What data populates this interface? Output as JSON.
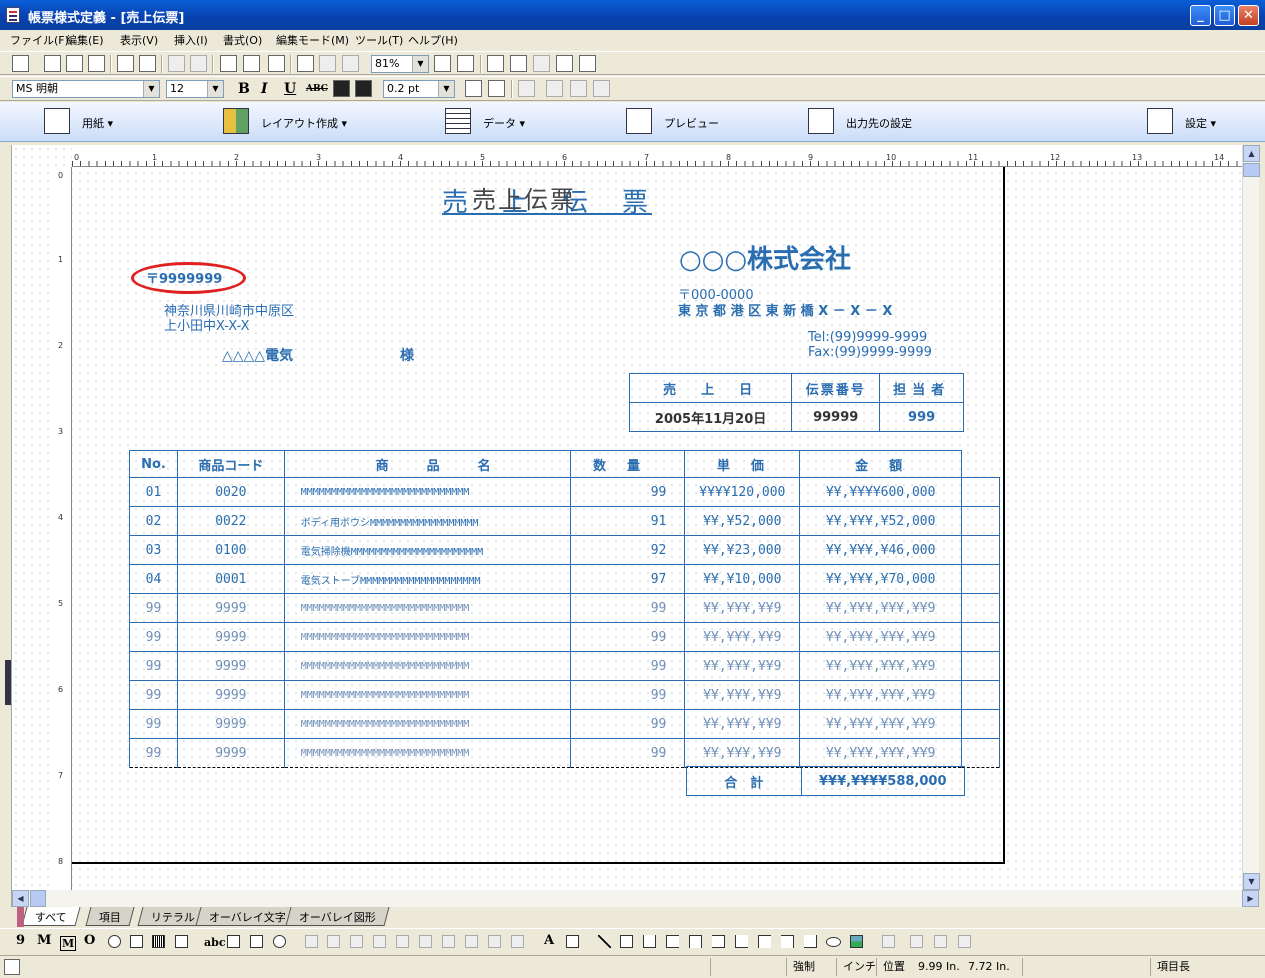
{
  "window": {
    "title": "帳票様式定義 - [売上伝票]",
    "min": "_",
    "max": "□",
    "close": "✕"
  },
  "menu": [
    "ファイル(F)",
    "編集(E)",
    "表示(V)",
    "挿入(I)",
    "書式(O)",
    "編集モード(M)",
    "ツール(T)",
    "ヘルプ(H)"
  ],
  "toolbar": {
    "zoom": "81%",
    "font": "MS 明朝",
    "font_size": "12",
    "line_width": "0.2 pt",
    "bold": "B",
    "italic": "I",
    "underline": "U",
    "strike": "ABC"
  },
  "bigbar": {
    "paper": "用紙",
    "layout": "レイアウト作成",
    "data": "データ",
    "preview": "プレビュー",
    "output": "出力先の設定",
    "settings": "設定"
  },
  "ruler": {
    "top": [
      "0",
      "1",
      "2",
      "3",
      "4",
      "5",
      "6",
      "7",
      "8",
      "9",
      "10",
      "11",
      "12",
      "13",
      "14"
    ],
    "left": [
      "0",
      "1",
      "2",
      "3",
      "4",
      "5",
      "6",
      "7",
      "8"
    ]
  },
  "form": {
    "title": "売　上　伝　票",
    "title_overlay": "売上伝票",
    "company": "○○○株式会社",
    "postal_code": "〒9999999",
    "address1": "神奈川県川崎市中原区",
    "address2": "上小田中X-X-X",
    "customer": "△△△△電気",
    "honorific": "様",
    "company_postal": "〒000-0000",
    "company_address": "東 京 都 港 区 東 新 橋 X － X － X",
    "tel": "Tel:(99)9999-9999",
    "fax": "Fax:(99)9999-9999",
    "header_cols": [
      "売　上　日",
      "伝票番号",
      "担当者"
    ],
    "header_vals": [
      "2005年11月20日",
      "99999",
      "999"
    ],
    "columns": [
      "No.",
      "商品コード",
      "商　　品　　名",
      "数　量",
      "単　価",
      "金　額"
    ],
    "rows": [
      {
        "no": "01",
        "code": "0020",
        "name": "MMMMMMMMMMMMMMMMMMMMMMMMMMMM",
        "qty": "99",
        "unit": "¥¥¥¥120,000",
        "amt": "¥¥,¥¥¥¥600,000",
        "dim": false
      },
      {
        "no": "02",
        "code": "0022",
        "name": "ボディ用ボウシMMMMMMMMMMMMMMMMMM",
        "qty": "91",
        "unit": "¥¥,¥52,000",
        "amt": "¥¥,¥¥¥,¥52,000",
        "dim": false
      },
      {
        "no": "03",
        "code": "0100",
        "name": "電気掃除機MMMMMMMMMMMMMMMMMMMMMM",
        "qty": "92",
        "unit": "¥¥,¥23,000",
        "amt": "¥¥,¥¥¥,¥46,000",
        "dim": false
      },
      {
        "no": "04",
        "code": "0001",
        "name": "電気ストーブMMMMMMMMMMMMMMMMMMMM",
        "qty": "97",
        "unit": "¥¥,¥10,000",
        "amt": "¥¥,¥¥¥,¥70,000",
        "dim": false
      },
      {
        "no": "99",
        "code": "9999",
        "name": "MMMMMMMMMMMMMMMMMMMMMMMMMMMM",
        "qty": "99",
        "unit": "¥¥,¥¥¥,¥¥9",
        "amt": "¥¥,¥¥¥,¥¥¥,¥¥9",
        "dim": true
      },
      {
        "no": "99",
        "code": "9999",
        "name": "MMMMMMMMMMMMMMMMMMMMMMMMMMMM",
        "qty": "99",
        "unit": "¥¥,¥¥¥,¥¥9",
        "amt": "¥¥,¥¥¥,¥¥¥,¥¥9",
        "dim": true
      },
      {
        "no": "99",
        "code": "9999",
        "name": "MMMMMMMMMMMMMMMMMMMMMMMMMMMM",
        "qty": "99",
        "unit": "¥¥,¥¥¥,¥¥9",
        "amt": "¥¥,¥¥¥,¥¥¥,¥¥9",
        "dim": true
      },
      {
        "no": "99",
        "code": "9999",
        "name": "MMMMMMMMMMMMMMMMMMMMMMMMMMMM",
        "qty": "99",
        "unit": "¥¥,¥¥¥,¥¥9",
        "amt": "¥¥,¥¥¥,¥¥¥,¥¥9",
        "dim": true
      },
      {
        "no": "99",
        "code": "9999",
        "name": "MMMMMMMMMMMMMMMMMMMMMMMMMMMM",
        "qty": "99",
        "unit": "¥¥,¥¥¥,¥¥9",
        "amt": "¥¥,¥¥¥,¥¥¥,¥¥9",
        "dim": true
      },
      {
        "no": "99",
        "code": "9999",
        "name": "MMMMMMMMMMMMMMMMMMMMMMMMMMMM",
        "qty": "99",
        "unit": "¥¥,¥¥¥,¥¥9",
        "amt": "¥¥,¥¥¥,¥¥¥,¥¥9",
        "dim": true
      }
    ],
    "total_label": "合　計",
    "total_value": "¥¥¥,¥¥¥¥588,000"
  },
  "tabs": [
    "すべて",
    "項目",
    "リテラル",
    "オーバレイ文字",
    "オーバレイ図形"
  ],
  "palette": [
    "9",
    "M",
    "M",
    "O",
    "abc",
    "A"
  ],
  "status": {
    "mode": "強制",
    "unit": "インチ",
    "position_label": "位置",
    "x": "9.99 In.",
    "y": "7.72 In.",
    "item": "項目長"
  },
  "colors": {
    "form_blue": "#2a6db0",
    "oval_red": "#e02020",
    "titlebar": "#0a5fd8"
  }
}
